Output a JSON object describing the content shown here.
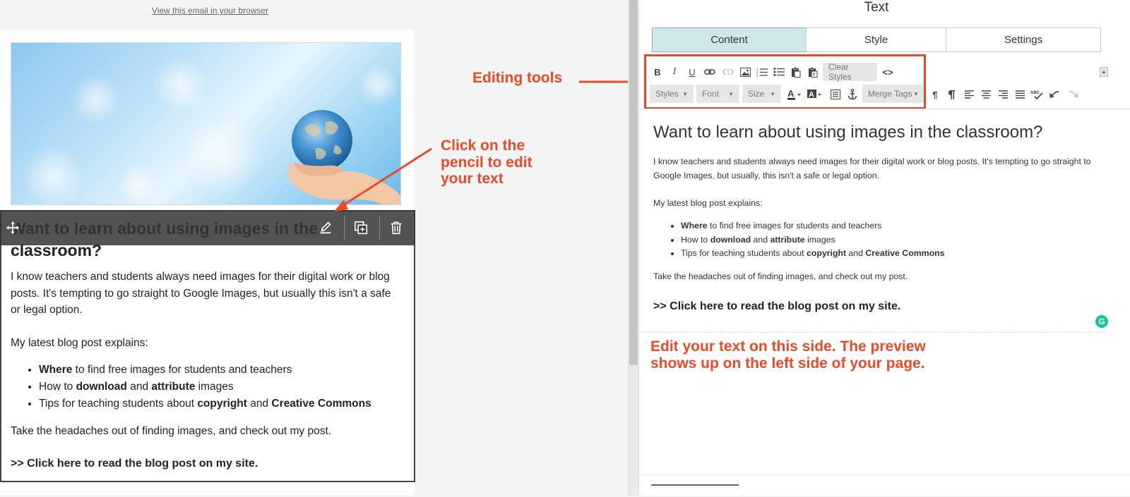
{
  "preview": {
    "view_in_browser": "View this email in your browser",
    "hero_image": "hands-holding-globe",
    "title": "Want to learn about using images in the classroom?",
    "intro": "I know teachers and students always need images for their digital work or blog posts. It's tempting to go straight to Google Images, but usually this isn't a safe or legal option.",
    "explains": "My latest blog post explains:",
    "bullets": [
      {
        "b1": "Where",
        "t1": " to find free images for students and teachers"
      },
      {
        "t0": "How to ",
        "b1": "download",
        "t1": " and ",
        "b2": "attribute",
        "t2": " images"
      },
      {
        "t0": "Tips for teaching students about ",
        "b1": "copyright",
        "t1": " and ",
        "b2": "Creative Commons"
      }
    ],
    "closing": "Take the headaches out of finding images, and check out my post.",
    "cta": ">> Click here to read the blog post on my site.",
    "toolbar_icons": [
      "move-icon",
      "pencil-icon",
      "duplicate-icon",
      "trash-icon"
    ]
  },
  "annotations": {
    "editing_tools": "Editing tools",
    "pencil_line1": "Click on the",
    "pencil_line2": "pencil to edit",
    "pencil_line3": "your text",
    "edit_line1": "Edit your text on this side. The preview",
    "edit_line2": "shows up on the left side of your page.",
    "color": "#ec4a27"
  },
  "editor": {
    "panel_title": "Text",
    "tabs": [
      "Content",
      "Style",
      "Settings"
    ],
    "active_tab": "Content",
    "toolbar": {
      "bold": "B",
      "italic": "I",
      "underline": "U",
      "clear_styles": "Clear Styles",
      "source": "<>",
      "styles": "Styles",
      "font": "Font",
      "size": "Size",
      "merge_tags": "Merge Tags",
      "pilcrow": "¶",
      "spellcheck": "ABC"
    },
    "title": "Want to learn about using images in the classroom?",
    "intro": "I know teachers and students always need images for their digital work or blog posts. It's tempting to go straight to Google Images, but usually, this isn't a safe or legal option.",
    "explains": "My latest blog post explains:",
    "bullets": [
      {
        "b1": "Where",
        "t1": " to find free images for students and teachers"
      },
      {
        "t0": "How to ",
        "b1": "download",
        "t1": " and ",
        "b2": "attribute",
        "t2": " images"
      },
      {
        "t0": "Tips for teaching students about ",
        "b1": "copyright",
        "t1": " and ",
        "b2": "Creative Commons"
      }
    ],
    "closing": "Take the headaches out of finding images, and check out my post.",
    "cta": ">> Click here to read the blog post on my site.",
    "grammarly_badge": "G"
  }
}
